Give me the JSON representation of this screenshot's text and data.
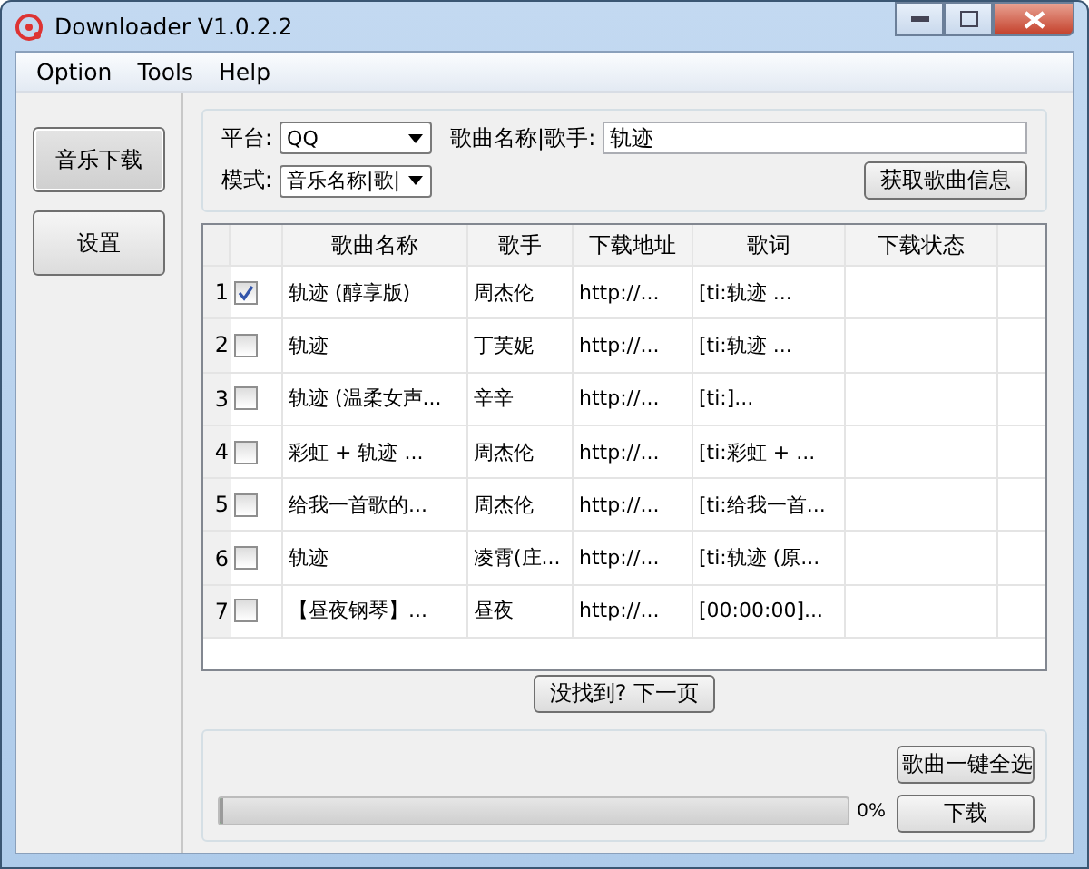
{
  "window": {
    "title": "Downloader V1.0.2.2"
  },
  "menu": [
    "Option",
    "Tools",
    "Help"
  ],
  "sidebar": {
    "items": [
      {
        "label": "音乐下载",
        "selected": true
      },
      {
        "label": "设置",
        "selected": false
      }
    ]
  },
  "search": {
    "platform_label": "平台:",
    "platform": "QQ",
    "mode_label": "模式:",
    "mode": "音乐名称|歌|",
    "query_label": "歌曲名称|歌手:",
    "query": "轨迹",
    "fetch_button": "获取歌曲信息"
  },
  "table": {
    "columns": [
      "歌曲名称",
      "歌手",
      "下载地址",
      "歌词",
      "下载状态"
    ],
    "rows": [
      {
        "index": "1",
        "checked": true,
        "cells": [
          "轨迹 (醇享版)",
          "周杰伦",
          "http://...",
          "[ti:轨迹 ...",
          ""
        ]
      },
      {
        "index": "2",
        "checked": false,
        "cells": [
          "轨迹",
          "丁芙妮",
          "http://...",
          "[ti:轨迹 ...",
          ""
        ]
      },
      {
        "index": "3",
        "checked": false,
        "cells": [
          "轨迹 (温柔女声...",
          "辛辛",
          "http://...",
          "[ti:]...",
          ""
        ]
      },
      {
        "index": "4",
        "checked": false,
        "cells": [
          "彩虹 + 轨迹 ...",
          "周杰伦",
          "http://...",
          "[ti:彩虹 + ...",
          ""
        ]
      },
      {
        "index": "5",
        "checked": false,
        "cells": [
          "给我一首歌的...",
          "周杰伦",
          "http://...",
          "[ti:给我一首...",
          ""
        ]
      },
      {
        "index": "6",
        "checked": false,
        "cells": [
          "轨迹",
          "凌霄(庄...",
          "http://...",
          "[ti:轨迹 (原...",
          ""
        ]
      },
      {
        "index": "7",
        "checked": false,
        "cells": [
          "【昼夜钢琴】...",
          "昼夜",
          "http://...",
          "[00:00:00]...",
          ""
        ]
      }
    ]
  },
  "next_page_button": "没找到? 下一页",
  "progress": {
    "level": 0,
    "reading": "0%"
  },
  "buttons": [
    "歌曲一键全选",
    "下载"
  ]
}
